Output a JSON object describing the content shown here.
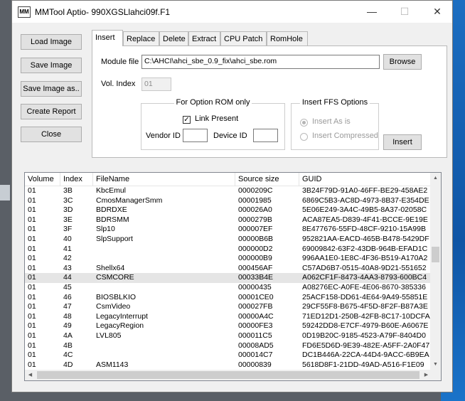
{
  "window": {
    "title": "MMTool Aptio- 990XGSLlahci09f.F1",
    "icon_text": "MM",
    "minimize": "—",
    "maximize": "☐",
    "close": "✕"
  },
  "side_buttons": {
    "load": "Load Image",
    "save": "Save Image",
    "save_as": "Save Image as..",
    "report": "Create Report",
    "close": "Close"
  },
  "tabs": [
    "Insert",
    "Replace",
    "Delete",
    "Extract",
    "CPU Patch",
    "RomHole"
  ],
  "insert": {
    "module_file_label": "Module file",
    "module_file_value": "C:\\AHCI\\ahci_sbe_0.9_fix\\ahci_sbe.rom",
    "browse": "Browse",
    "vol_index_label": "Vol. Index",
    "vol_index_value": "01",
    "option_rom_group": "For Option ROM only",
    "link_present": "Link Present",
    "link_present_checked": "✓",
    "vendor_id_label": "Vendor ID",
    "device_id_label": "Device ID",
    "ffs_group": "Insert FFS Options",
    "insert_as_is": "Insert As is",
    "insert_compressed": "Insert Compressed",
    "insert_button": "Insert"
  },
  "table": {
    "columns": [
      "Volume",
      "Index",
      "FileName",
      "Source size",
      "GUID"
    ],
    "selected_row": 9,
    "rows": [
      [
        "01",
        "3B",
        "KbcEmul",
        "0000209C",
        "3B24F79D-91A0-46FF-BE29-458AE2"
      ],
      [
        "01",
        "3C",
        "CmosManagerSmm",
        "00001985",
        "6869C5B3-AC8D-4973-8B37-E354DE"
      ],
      [
        "01",
        "3D",
        "BDRDXE",
        "000026A0",
        "5E06E249-3A4C-49B5-8A37-02058C"
      ],
      [
        "01",
        "3E",
        "BDRSMM",
        "0000279B",
        "ACA87EA5-D839-4F41-BCCE-9E19E"
      ],
      [
        "01",
        "3F",
        "Slp10",
        "000007EF",
        "8E477676-55FD-48CF-9210-15A99B"
      ],
      [
        "01",
        "40",
        "SlpSupport",
        "00000B6B",
        "952821AA-EACD-465B-B478-5429DF"
      ],
      [
        "01",
        "41",
        "",
        "000000D2",
        "69009842-63F2-43DB-964B-EFAD1C"
      ],
      [
        "01",
        "42",
        "",
        "000000B9",
        "996AA1E0-1E8C-4F36-B519-A170A2"
      ],
      [
        "01",
        "43",
        "Shellx64",
        "000456AF",
        "C57AD6B7-0515-40A8-9D21-551652"
      ],
      [
        "01",
        "44",
        "CSMCORE",
        "00033B4E",
        "A062CF1F-8473-4AA3-8793-600BC4"
      ],
      [
        "01",
        "45",
        "",
        "00000435",
        "A08276EC-A0FE-4E06-8670-385336"
      ],
      [
        "01",
        "46",
        "BIOSBLKIO",
        "00001CE0",
        "25ACF158-DD61-4E64-9A49-55851E"
      ],
      [
        "01",
        "47",
        "CsmVideo",
        "000027FB",
        "29CF55F8-B675-4F5D-8F2F-B87A3E"
      ],
      [
        "01",
        "48",
        "LegacyInterrupt",
        "00000A4C",
        "71ED12D1-250B-42FB-8C17-10DCFA"
      ],
      [
        "01",
        "49",
        "LegacyRegion",
        "00000FE3",
        "59242DD8-E7CF-4979-B60E-A6067E"
      ],
      [
        "01",
        "4A",
        "LVL805",
        "000011C5",
        "0D19B20C-9185-4523-A79F-8404D0"
      ],
      [
        "01",
        "4B",
        "",
        "00008AD5",
        "FD6E5D6D-9E39-482E-A5FF-2A0F47"
      ],
      [
        "01",
        "4C",
        "",
        "000014C7",
        "DC1B446A-22CA-44D4-9ACC-6B9EA"
      ],
      [
        "01",
        "4D",
        "ASM1143",
        "00000839",
        "5618D8F1-21DD-49AD-A516-F1E09"
      ]
    ]
  },
  "scroll": {
    "up": "▲",
    "down": "▼",
    "left": "◀",
    "right": "▶"
  }
}
